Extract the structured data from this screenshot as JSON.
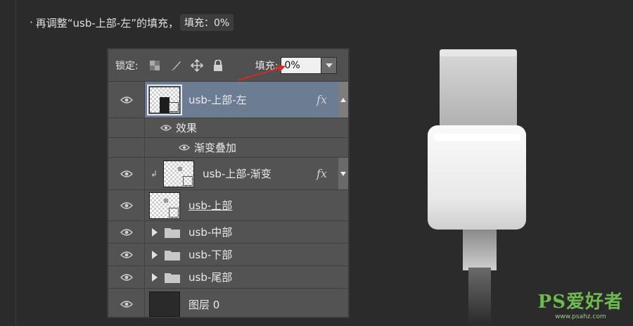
{
  "caption": {
    "bullet": "·",
    "text": "再调整“usb-上部-左”的填充，",
    "code": "填充：0%"
  },
  "panel": {
    "lock_label": "锁定:",
    "fill_label": "填充:",
    "fill_value": "0%",
    "layers": [
      {
        "name": "usb-上部-左",
        "selected": true,
        "fx": "fx"
      },
      {
        "name": "效果"
      },
      {
        "name": "渐变叠加"
      },
      {
        "name": "usb-上部-渐变",
        "fx": "fx"
      },
      {
        "name": "usb-上部"
      },
      {
        "name": "usb-中部"
      },
      {
        "name": "usb-下部"
      },
      {
        "name": "usb-尾部"
      },
      {
        "name": "图层 0"
      }
    ]
  },
  "watermark": {
    "brand": "PS爱好者",
    "url": "www.psahz.com"
  },
  "colors": {
    "background": "#2b2b2b",
    "panel": "#535353",
    "selected_row": "#6c7c92",
    "arrow": "#d42a2a"
  }
}
